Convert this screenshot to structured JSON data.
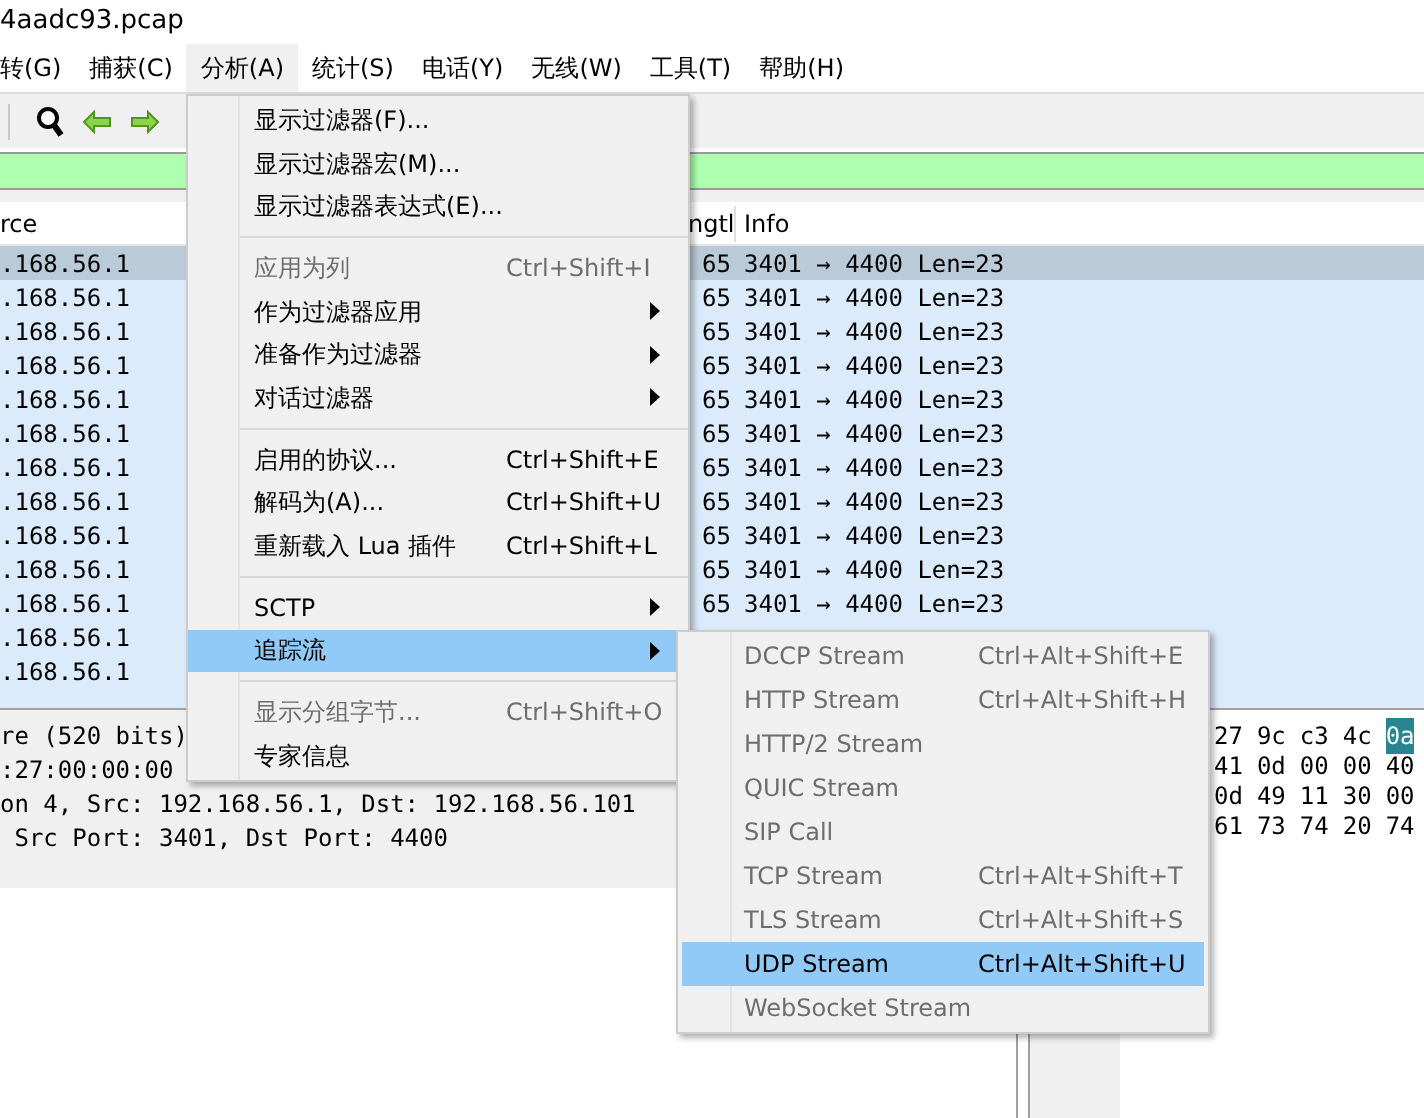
{
  "window": {
    "title": "4aadc93.pcap"
  },
  "menubar": [
    {
      "label": "转(G)",
      "selected": false
    },
    {
      "label": "捕获(C)",
      "selected": false
    },
    {
      "label": "分析(A)",
      "selected": true
    },
    {
      "label": "统计(S)",
      "selected": false
    },
    {
      "label": "电话(Y)",
      "selected": false
    },
    {
      "label": "无线(W)",
      "selected": false
    },
    {
      "label": "工具(T)",
      "selected": false
    },
    {
      "label": "帮助(H)",
      "selected": false
    }
  ],
  "packet_list": {
    "columns": [
      "rce",
      "ngtl",
      "Info"
    ],
    "rows": [
      {
        "source": ".168.56.1",
        "length": "65",
        "info": "3401 → 4400 Len=23",
        "selected": true
      },
      {
        "source": ".168.56.1",
        "length": "65",
        "info": "3401 → 4400 Len=23",
        "selected": false
      },
      {
        "source": ".168.56.1",
        "length": "65",
        "info": "3401 → 4400 Len=23",
        "selected": false
      },
      {
        "source": ".168.56.1",
        "length": "65",
        "info": "3401 → 4400 Len=23",
        "selected": false
      },
      {
        "source": ".168.56.1",
        "length": "65",
        "info": "3401 → 4400 Len=23",
        "selected": false
      },
      {
        "source": ".168.56.1",
        "length": "65",
        "info": "3401 → 4400 Len=23",
        "selected": false
      },
      {
        "source": ".168.56.1",
        "length": "65",
        "info": "3401 → 4400 Len=23",
        "selected": false
      },
      {
        "source": ".168.56.1",
        "length": "65",
        "info": "3401 → 4400 Len=23",
        "selected": false
      },
      {
        "source": ".168.56.1",
        "length": "65",
        "info": "3401 → 4400 Len=23",
        "selected": false
      },
      {
        "source": ".168.56.1",
        "length": "65",
        "info": "3401 → 4400 Len=23",
        "selected": false
      },
      {
        "source": ".168.56.1",
        "length": "65",
        "info": "3401 → 4400 Len=23",
        "selected": false
      },
      {
        "source": ".168.56.1",
        "selected": false
      },
      {
        "source": ".168.56.1",
        "selected": false
      }
    ]
  },
  "packet_details": [
    "re (520 bits)",
    ":27:00:00:00",
    "on 4, Src: 192.168.56.1, Dst: 192.168.56.101",
    " Src Port: 3401, Dst Port: 4400"
  ],
  "packet_bytes": [
    [
      {
        "text": "27",
        "selected": false
      },
      {
        "text": "9c",
        "selected": false
      },
      {
        "text": "c3",
        "selected": false
      },
      {
        "text": "4c",
        "selected": false
      },
      {
        "text": "0a",
        "selected": true
      }
    ],
    [
      {
        "text": "41",
        "selected": false
      },
      {
        "text": "0d",
        "selected": false
      },
      {
        "text": "00",
        "selected": false
      },
      {
        "text": "00",
        "selected": false
      },
      {
        "text": "40",
        "selected": false
      }
    ],
    [
      {
        "text": "0d",
        "selected": false
      },
      {
        "text": "49",
        "selected": false
      },
      {
        "text": "11",
        "selected": false
      },
      {
        "text": "30",
        "selected": false
      },
      {
        "text": "00",
        "selected": false
      }
    ],
    [
      {
        "text": "61",
        "selected": false
      },
      {
        "text": "73",
        "selected": false
      },
      {
        "text": "74",
        "selected": false
      },
      {
        "text": "20",
        "selected": false
      },
      {
        "text": "74",
        "selected": false
      }
    ]
  ],
  "analyze_menu": [
    {
      "kind": "item",
      "label": "显示过滤器(F)...",
      "disabled": false,
      "submenu": false,
      "selected": false
    },
    {
      "kind": "item",
      "label": "显示过滤器宏(M)...",
      "disabled": false,
      "submenu": false,
      "selected": false
    },
    {
      "kind": "item",
      "label": "显示过滤器表达式(E)...",
      "disabled": false,
      "submenu": false,
      "selected": false
    },
    {
      "kind": "separator"
    },
    {
      "kind": "item",
      "label": "应用为列",
      "shortcut": "Ctrl+Shift+I",
      "disabled": true,
      "submenu": false,
      "selected": false
    },
    {
      "kind": "item",
      "label": "作为过滤器应用",
      "disabled": false,
      "submenu": true,
      "selected": false
    },
    {
      "kind": "item",
      "label": "准备作为过滤器",
      "disabled": false,
      "submenu": true,
      "selected": false
    },
    {
      "kind": "item",
      "label": "对话过滤器",
      "disabled": false,
      "submenu": true,
      "selected": false
    },
    {
      "kind": "separator"
    },
    {
      "kind": "item",
      "label": "启用的协议...",
      "shortcut": "Ctrl+Shift+E",
      "disabled": false,
      "submenu": false,
      "selected": false
    },
    {
      "kind": "item",
      "label": "解码为(A)...",
      "shortcut": "Ctrl+Shift+U",
      "disabled": false,
      "submenu": false,
      "selected": false
    },
    {
      "kind": "item",
      "label": "重新载入 Lua 插件",
      "shortcut": "Ctrl+Shift+L",
      "disabled": false,
      "submenu": false,
      "selected": false
    },
    {
      "kind": "separator"
    },
    {
      "kind": "item",
      "label": "SCTP",
      "disabled": false,
      "submenu": true,
      "selected": false
    },
    {
      "kind": "item",
      "label": "追踪流",
      "disabled": false,
      "submenu": true,
      "selected": true
    },
    {
      "kind": "separator"
    },
    {
      "kind": "item",
      "label": "显示分组字节...",
      "shortcut": "Ctrl+Shift+O",
      "disabled": true,
      "submenu": false,
      "selected": false
    },
    {
      "kind": "item",
      "label": "专家信息",
      "disabled": false,
      "submenu": false,
      "selected": false
    }
  ],
  "follow_stream_menu": [
    {
      "label": "DCCP Stream",
      "shortcut": "Ctrl+Alt+Shift+E",
      "disabled": true,
      "selected": false
    },
    {
      "label": "HTTP Stream",
      "shortcut": "Ctrl+Alt+Shift+H",
      "disabled": true,
      "selected": false
    },
    {
      "label": "HTTP/2 Stream",
      "disabled": true,
      "selected": false
    },
    {
      "label": "QUIC Stream",
      "disabled": true,
      "selected": false
    },
    {
      "label": "SIP Call",
      "disabled": true,
      "selected": false
    },
    {
      "label": "TCP Stream",
      "shortcut": "Ctrl+Alt+Shift+T",
      "disabled": true,
      "selected": false
    },
    {
      "label": "TLS Stream",
      "shortcut": "Ctrl+Alt+Shift+S",
      "disabled": true,
      "selected": false
    },
    {
      "label": "UDP Stream",
      "shortcut": "Ctrl+Alt+Shift+U",
      "disabled": false,
      "selected": true
    },
    {
      "label": "WebSocket Stream",
      "disabled": true,
      "selected": false
    }
  ]
}
